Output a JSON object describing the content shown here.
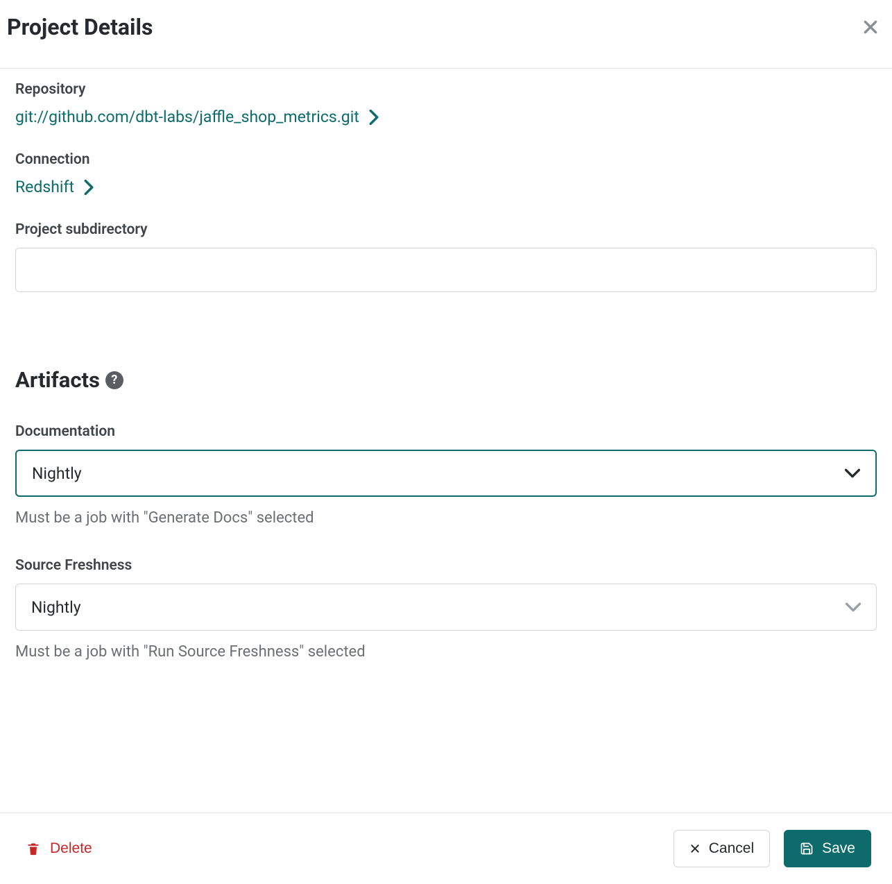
{
  "header": {
    "title": "Project Details"
  },
  "repository": {
    "label": "Repository",
    "url": "git://github.com/dbt-labs/jaffle_shop_metrics.git"
  },
  "connection": {
    "label": "Connection",
    "name": "Redshift"
  },
  "subdirectory": {
    "label": "Project subdirectory",
    "value": ""
  },
  "artifacts": {
    "heading": "Artifacts",
    "documentation": {
      "label": "Documentation",
      "selected": "Nightly",
      "helper": "Must be a job with \"Generate Docs\" selected"
    },
    "source_freshness": {
      "label": "Source Freshness",
      "selected": "Nightly",
      "helper": "Must be a job with \"Run Source Freshness\" selected"
    }
  },
  "footer": {
    "delete": "Delete",
    "cancel": "Cancel",
    "save": "Save"
  }
}
